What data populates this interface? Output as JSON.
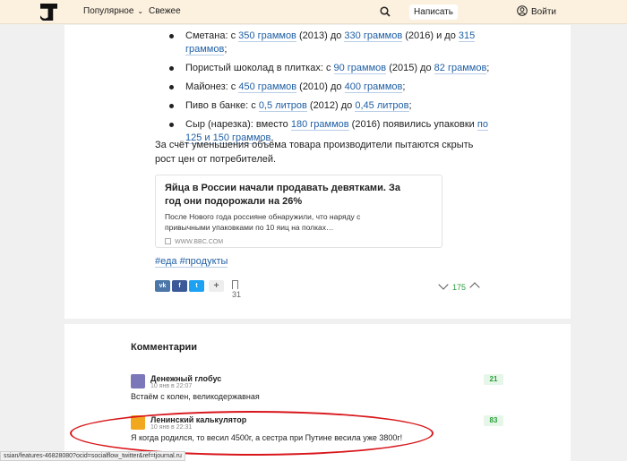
{
  "header": {
    "nav_popular": "Популярное",
    "nav_fresh": "Свежее",
    "write_button": "Написать",
    "login": "Войти",
    "icons": [
      "tj-logo-icon",
      "chevron-down-icon",
      "search-icon",
      "user-icon"
    ]
  },
  "article": {
    "bullets": [
      {
        "prefix": "Сметана: с ",
        "a": "350 граммов",
        "mid1": " (2013) до ",
        "b": "330 граммов",
        "mid2": " (2016) и до ",
        "c": "315 граммов",
        "end": ";"
      },
      {
        "prefix": "Пористый шоколад в плитках: с ",
        "a": "90 граммов",
        "mid1": " (2015) до ",
        "b": "82 граммов",
        "end": ";"
      },
      {
        "prefix": "Майонез: с ",
        "a": "450 граммов",
        "mid1": " (2010) до ",
        "b": "400 граммов",
        "end": ";"
      },
      {
        "prefix": "Пиво в банке: с ",
        "a": "0,5 литров",
        "mid1": " (2012) до ",
        "b": "0,45 литров",
        "end": ";"
      },
      {
        "prefix": "Сыр (нарезка): вместо ",
        "a": "180 граммов",
        "mid1": " (2016) появились упаковки ",
        "b": "по 125 и 150 граммов",
        "end": "."
      }
    ],
    "paragraph": "За счёт уменьшения объёма товара производители пытаются скрыть рост цен от потребителей.",
    "embed": {
      "title": "Яйца в России начали продавать девятками. За год они подорожали на 26%",
      "description": "После Нового года россияне обнаружили, что наряду с привычными упаковками по 10 яиц на полках…",
      "source": "WWW.BBC.COM"
    },
    "tags": "#еда #продукты",
    "share": {
      "vk": "vk",
      "fb": "f",
      "tw": "t",
      "more": "+"
    },
    "bookmarks": "31",
    "rating": "175"
  },
  "comments": {
    "title": "Комментарии",
    "items": [
      {
        "author": "Денежный глобус",
        "date": "10 янв в 22:07",
        "text": "Встаём с колен, великодержавная",
        "score": "21"
      },
      {
        "author": "Ленинский калькулятор",
        "date": "10 янв в 22:31",
        "text": "Я когда родился, то весил 4500г, а сестра при Путине весила уже 3800г!",
        "score": "83"
      }
    ]
  },
  "status_bar": "ssian/features-46828080?ocid=socialflow_twitter&ref=tjournal.ru",
  "colors": {
    "header_bg": "#fcf0de",
    "link": "#1f5fa5",
    "positive": "#2a9d3a",
    "annotation": "#d8161b"
  }
}
